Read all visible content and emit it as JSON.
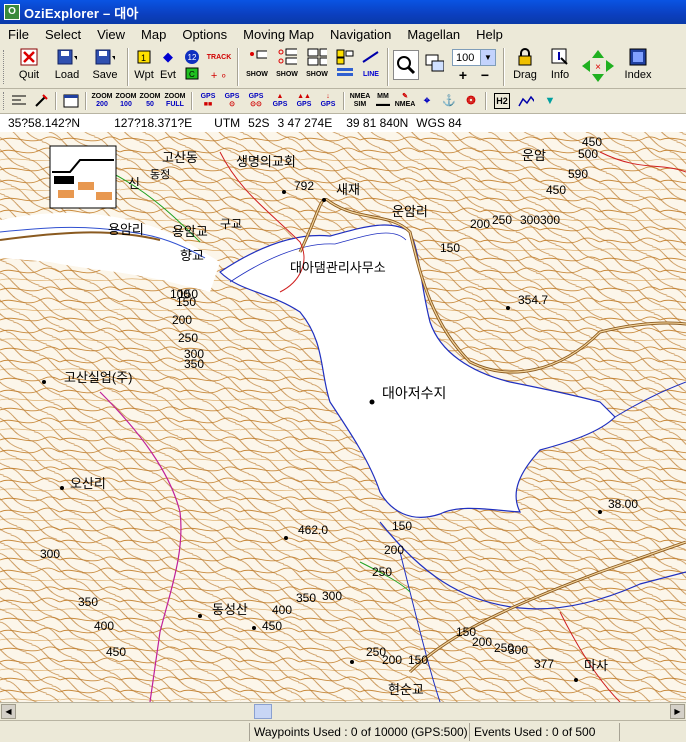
{
  "window": {
    "title": "OziExplorer – 대아"
  },
  "menu": [
    "File",
    "Select",
    "View",
    "Map",
    "Options",
    "Moving Map",
    "Navigation",
    "Magellan",
    "Help"
  ],
  "toolbar": {
    "quit": "Quit",
    "load": "Load",
    "save": "Save",
    "wpt": "Wpt",
    "evt": "Evt",
    "badge12": "12",
    "track": "TRACK",
    "show": "SHOW",
    "line": "LINE",
    "zoom_value": "100",
    "drag": "Drag",
    "info": "Info",
    "index": "Index"
  },
  "toolbar2": {
    "zoom200": "200",
    "zoom100": "100",
    "zoom50": "50",
    "zoomfull": "FULL",
    "zoomword": "ZOOM",
    "gps": "GPS",
    "nmea": "NMEA",
    "sim": "SIM",
    "mm": "MM",
    "h2": "H2"
  },
  "coords": {
    "lat": "35?58.142?N",
    "lon": "127?18.371?E",
    "utm_label": "UTM",
    "zone": "52S",
    "easting": "3 47 274E",
    "northing": "39 81 840N",
    "datum": "WGS 84"
  },
  "map": {
    "labels": [
      "고산동",
      "생명의교회",
      "792",
      "새재",
      "운암리",
      "450",
      "500",
      "590",
      "450",
      "운암",
      "300",
      "200",
      "250",
      "300",
      "150",
      "신",
      "동정",
      "용암리",
      "용암교",
      "구교",
      "향교",
      "대아댐관리사무소",
      "150",
      "100",
      "150",
      "200",
      "250",
      "300",
      "350",
      "354.7",
      "고산실업(주)",
      "대아저수지",
      "오산리",
      "38.00",
      "462.0",
      "150",
      "200",
      "250",
      "300",
      "350",
      "400",
      "450",
      "동성산",
      "400",
      "450",
      "350",
      "300",
      "150",
      "200",
      "250",
      "300",
      "250",
      "200",
      "150",
      "377",
      "마사",
      "현순교"
    ]
  },
  "status": {
    "waypoints": "Waypoints Used : 0 of 10000  (GPS:500)",
    "events": "Events Used : 0 of 500"
  }
}
